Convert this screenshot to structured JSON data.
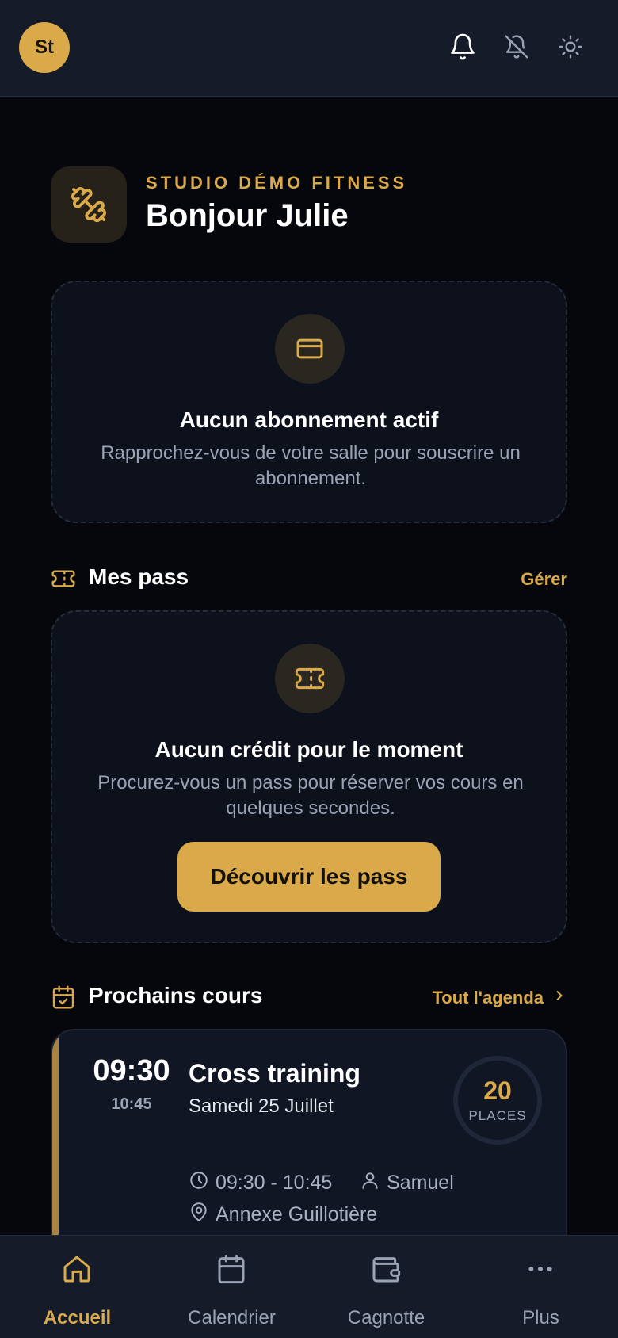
{
  "topbar": {
    "avatar_initials": "St",
    "icons": [
      "bell-icon",
      "bell-off-icon",
      "sun-icon"
    ]
  },
  "header": {
    "studio_name": "STUDIO DÉMO FITNESS",
    "greeting": "Bonjour Julie",
    "brand_icon": "dumbbell-icon"
  },
  "subscription_card": {
    "icon": "credit-card-icon",
    "title": "Aucun abonnement actif",
    "text": "Rapprochez-vous de votre salle pour souscrire un abonnement."
  },
  "passes_section": {
    "icon": "ticket-icon",
    "title": "Mes pass",
    "link": "Gérer"
  },
  "passes_card": {
    "icon": "ticket-icon",
    "title": "Aucun crédit pour le moment",
    "text": "Procurez-vous un pass pour réserver vos cours en quelques secondes.",
    "button": "Découvrir les pass"
  },
  "courses_section": {
    "icon": "calendar-check-icon",
    "title": "Prochains cours",
    "link": "Tout l'agenda"
  },
  "course": {
    "start_time": "09:30",
    "end_time": "10:45",
    "title": "Cross training",
    "date": "Samedi 25 Juillet",
    "places_count": "20",
    "places_label": "PLACES",
    "time_range": "09:30 - 10:45",
    "coach": "Samuel",
    "location": "Annexe Guillotière"
  },
  "bottom_nav": {
    "items": [
      {
        "label": "Accueil",
        "icon": "home-icon",
        "active": true
      },
      {
        "label": "Calendrier",
        "icon": "calendar-icon",
        "active": false
      },
      {
        "label": "Cagnotte",
        "icon": "wallet-icon",
        "active": false
      },
      {
        "label": "Plus",
        "icon": "more-icon",
        "active": false
      }
    ]
  },
  "colors": {
    "accent": "#d9a94a",
    "background": "#05070d",
    "bar": "#161b2a",
    "card": "#0c111c",
    "muted_text": "#9aa3b4"
  }
}
